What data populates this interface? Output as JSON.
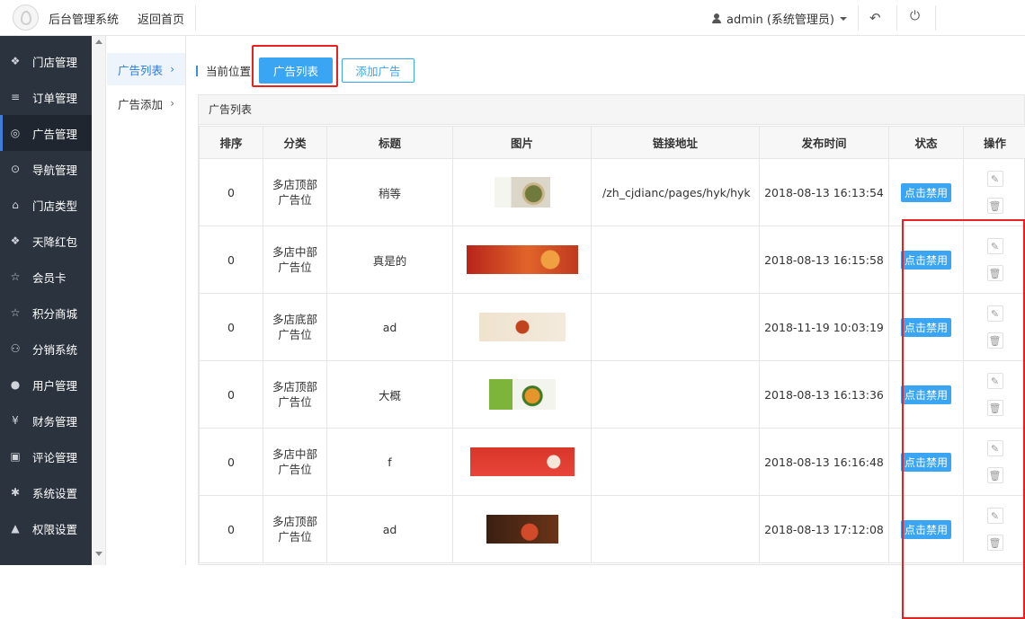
{
  "topbar": {
    "app_title": "后台管理系统",
    "home_link": "返回首页",
    "user_label": "admin (系统管理员)",
    "icons": {
      "user": "user-icon",
      "back": "reply-icon",
      "power": "power-icon"
    }
  },
  "sidebar": {
    "items": [
      {
        "label": "门店管理",
        "icon": "cubes-icon",
        "glyph": "❖"
      },
      {
        "label": "订单管理",
        "icon": "list-icon",
        "glyph": "≡"
      },
      {
        "label": "广告管理",
        "icon": "lifebuoy-icon",
        "glyph": "◎",
        "active": true
      },
      {
        "label": "导航管理",
        "icon": "compass-icon",
        "glyph": "⊙"
      },
      {
        "label": "门店类型",
        "icon": "bank-icon",
        "glyph": "⌂"
      },
      {
        "label": "天降红包",
        "icon": "cubes-icon",
        "glyph": "❖"
      },
      {
        "label": "会员卡",
        "icon": "star-icon",
        "glyph": "☆"
      },
      {
        "label": "积分商城",
        "icon": "star-icon",
        "glyph": "☆"
      },
      {
        "label": "分销系统",
        "icon": "users-icon",
        "glyph": "⚇"
      },
      {
        "label": "用户管理",
        "icon": "user-icon",
        "glyph": "●"
      },
      {
        "label": "财务管理",
        "icon": "yen-icon",
        "glyph": "¥"
      },
      {
        "label": "评论管理",
        "icon": "money-icon",
        "glyph": "▣"
      },
      {
        "label": "系统设置",
        "icon": "gear-icon",
        "glyph": "✱"
      },
      {
        "label": "权限设置",
        "icon": "lock-icon",
        "glyph": "▲"
      }
    ]
  },
  "subnav": {
    "items": [
      {
        "label": "广告列表",
        "active": true
      },
      {
        "label": "广告添加",
        "active": false
      }
    ]
  },
  "main": {
    "crumb_label": "当前位置:",
    "primary_button": "广告列表",
    "add_button": "添加广告",
    "panel_title": "广告列表",
    "columns": [
      "排序",
      "分类",
      "标题",
      "图片",
      "链接地址",
      "发布时间",
      "状态",
      "操作"
    ],
    "status_button": "点击禁用",
    "rows": [
      {
        "sort": "0",
        "category": "多店顶部广告位",
        "title": "稍等",
        "image": "banner-food-1",
        "link": "/zh_cjdianc/pages/hyk/hyk",
        "time": "2018-08-13 16:13:54"
      },
      {
        "sort": "0",
        "category": "多店中部广告位",
        "title": "真是的",
        "image": "banner-food-2",
        "link": "",
        "time": "2018-08-13 16:15:58"
      },
      {
        "sort": "0",
        "category": "多店底部广告位",
        "title": "ad",
        "image": "banner-food-3",
        "link": "",
        "time": "2018-11-19 10:03:19"
      },
      {
        "sort": "0",
        "category": "多店顶部广告位",
        "title": "大概",
        "image": "banner-food-4",
        "link": "",
        "time": "2018-08-13 16:13:36"
      },
      {
        "sort": "0",
        "category": "多店中部广告位",
        "title": "f",
        "image": "banner-food-5",
        "link": "",
        "time": "2018-08-13 16:16:48"
      },
      {
        "sort": "0",
        "category": "多店顶部广告位",
        "title": "ad",
        "image": "banner-food-6",
        "link": "",
        "time": "2018-08-13 17:12:08"
      }
    ]
  },
  "colors": {
    "accent": "#3aa5f2",
    "sidebar_bg": "#2b333e",
    "highlight": "#e82020"
  }
}
